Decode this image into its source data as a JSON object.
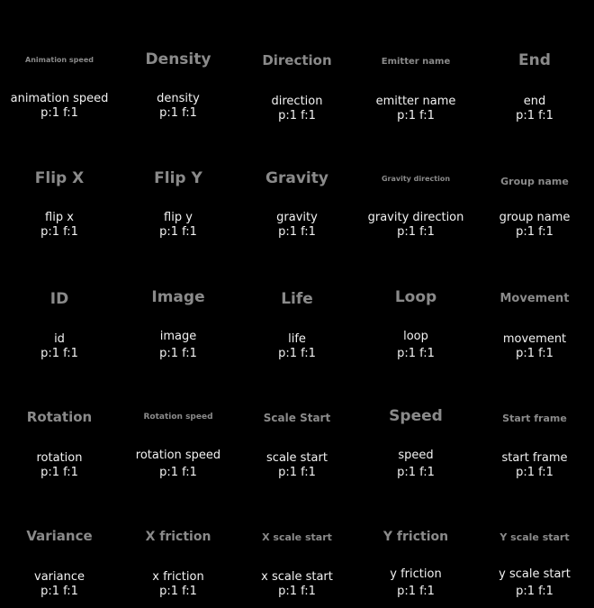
{
  "cells": [
    {
      "title": "Animation speed",
      "name": "animation speed",
      "stats": "p:1 f:1"
    },
    {
      "title": "Density",
      "name": "density",
      "stats": "p:1 f:1"
    },
    {
      "title": "Direction",
      "name": "direction",
      "stats": "p:1 f:1"
    },
    {
      "title": "Emitter name",
      "name": "emitter name",
      "stats": "p:1 f:1"
    },
    {
      "title": "End",
      "name": "end",
      "stats": "p:1 f:1"
    },
    {
      "title": "Flip X",
      "name": "flip x",
      "stats": "p:1 f:1"
    },
    {
      "title": "Flip Y",
      "name": "flip y",
      "stats": "p:1 f:1"
    },
    {
      "title": "Gravity",
      "name": "gravity",
      "stats": "p:1 f:1"
    },
    {
      "title": "Gravity direction",
      "name": "gravity direction",
      "stats": "p:1 f:1"
    },
    {
      "title": "Group name",
      "name": "group name",
      "stats": "p:1 f:1"
    },
    {
      "title": "ID",
      "name": "id",
      "stats": "p:1 f:1"
    },
    {
      "title": "Image",
      "name": "image",
      "stats": "p:1 f:1"
    },
    {
      "title": "Life",
      "name": "life",
      "stats": "p:1 f:1"
    },
    {
      "title": "Loop",
      "name": "loop",
      "stats": "p:1 f:1"
    },
    {
      "title": "Movement",
      "name": "movement",
      "stats": "p:1 f:1"
    },
    {
      "title": "Rotation",
      "name": "rotation",
      "stats": "p:1 f:1"
    },
    {
      "title": "Rotation speed",
      "name": "rotation speed",
      "stats": "p:1 f:1"
    },
    {
      "title": "Scale Start",
      "name": "scale start",
      "stats": "p:1 f:1"
    },
    {
      "title": "Speed",
      "name": "speed",
      "stats": "p:1 f:1"
    },
    {
      "title": "Start frame",
      "name": "start frame",
      "stats": "p:1 f:1"
    },
    {
      "title": "Variance",
      "name": "variance",
      "stats": "p:1 f:1"
    },
    {
      "title": "X friction",
      "name": "x friction",
      "stats": "p:1 f:1"
    },
    {
      "title": "X scale start",
      "name": "x scale start",
      "stats": "p:1 f:1"
    },
    {
      "title": "Y friction",
      "name": "y friction",
      "stats": "p:1 f:1"
    },
    {
      "title": "Y scale start",
      "name": "y scale start",
      "stats": "p:1 f:1"
    }
  ]
}
